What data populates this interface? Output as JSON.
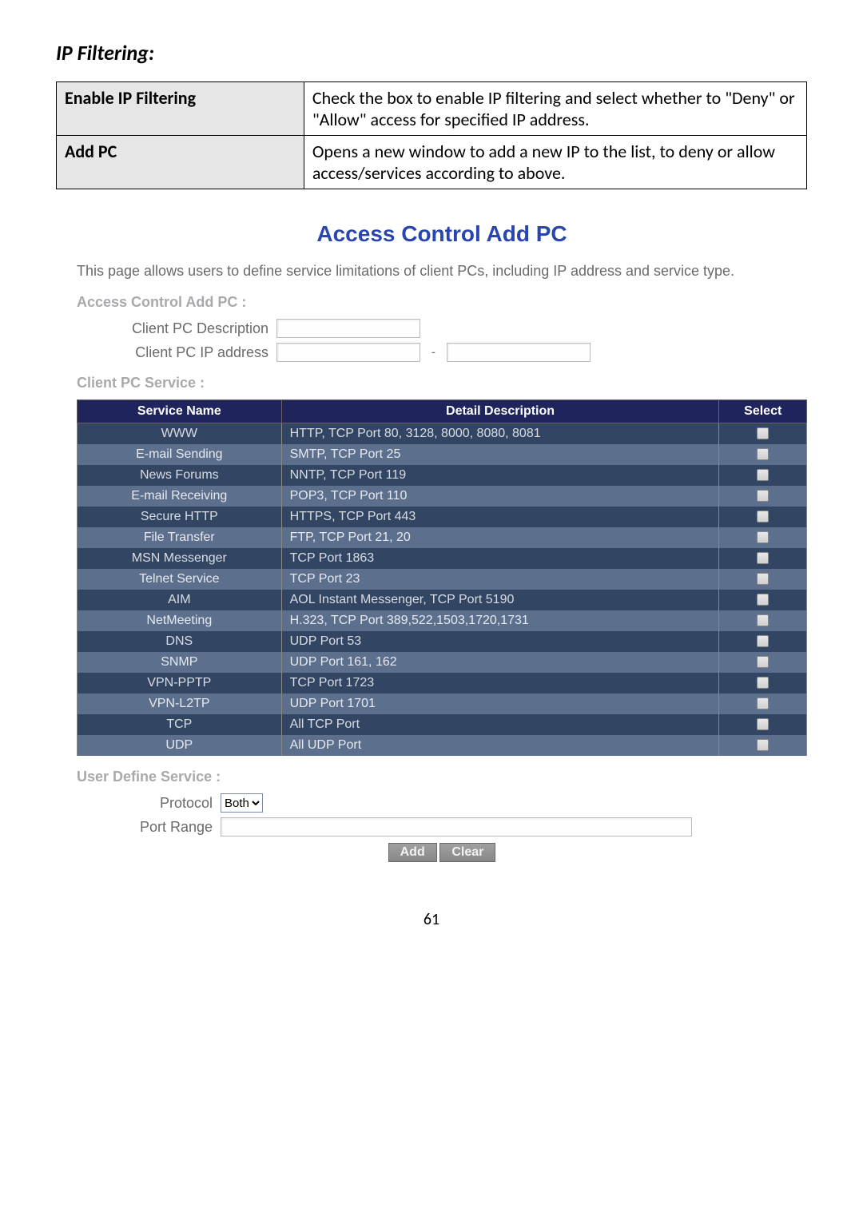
{
  "heading": "IP Filtering:",
  "doc_table": {
    "rows": [
      {
        "term": "Enable IP Filtering",
        "desc": "Check the box to enable IP filtering and select whether to \"Deny\" or \"Allow\" access for specified IP address."
      },
      {
        "term": "Add PC",
        "desc": "Opens a new window to add a new IP to the list, to deny or allow access/services according to above."
      }
    ]
  },
  "panel": {
    "title": "Access Control Add PC",
    "desc": "This page allows users to define service limitations of client PCs, including IP address and service type.",
    "section_add_pc": "Access Control Add PC :",
    "label_desc": "Client PC Description",
    "label_ip": "Client PC IP address",
    "ip_dash": "-",
    "section_service": "Client PC Service :",
    "service_headers": [
      "Service Name",
      "Detail Description",
      "Select"
    ],
    "services": [
      {
        "name": "WWW",
        "desc": "HTTP, TCP Port 80, 3128, 8000, 8080, 8081"
      },
      {
        "name": "E-mail Sending",
        "desc": "SMTP, TCP Port 25"
      },
      {
        "name": "News Forums",
        "desc": "NNTP, TCP Port 119"
      },
      {
        "name": "E-mail Receiving",
        "desc": "POP3, TCP Port 110"
      },
      {
        "name": "Secure HTTP",
        "desc": "HTTPS, TCP Port 443"
      },
      {
        "name": "File Transfer",
        "desc": "FTP, TCP Port 21, 20"
      },
      {
        "name": "MSN Messenger",
        "desc": "TCP Port 1863"
      },
      {
        "name": "Telnet Service",
        "desc": "TCP Port 23"
      },
      {
        "name": "AIM",
        "desc": "AOL Instant Messenger, TCP Port 5190"
      },
      {
        "name": "NetMeeting",
        "desc": "H.323, TCP Port 389,522,1503,1720,1731"
      },
      {
        "name": "DNS",
        "desc": "UDP Port 53"
      },
      {
        "name": "SNMP",
        "desc": "UDP Port 161, 162"
      },
      {
        "name": "VPN-PPTP",
        "desc": "TCP Port 1723"
      },
      {
        "name": "VPN-L2TP",
        "desc": "UDP Port 1701"
      },
      {
        "name": "TCP",
        "desc": "All TCP Port"
      },
      {
        "name": "UDP",
        "desc": "All UDP Port"
      }
    ],
    "section_user": "User Define Service :",
    "label_protocol": "Protocol",
    "protocol_options": [
      "Both"
    ],
    "protocol_selected": "Both",
    "label_range": "Port Range",
    "btn_add": "Add",
    "btn_clear": "Clear"
  },
  "page_number": "61"
}
